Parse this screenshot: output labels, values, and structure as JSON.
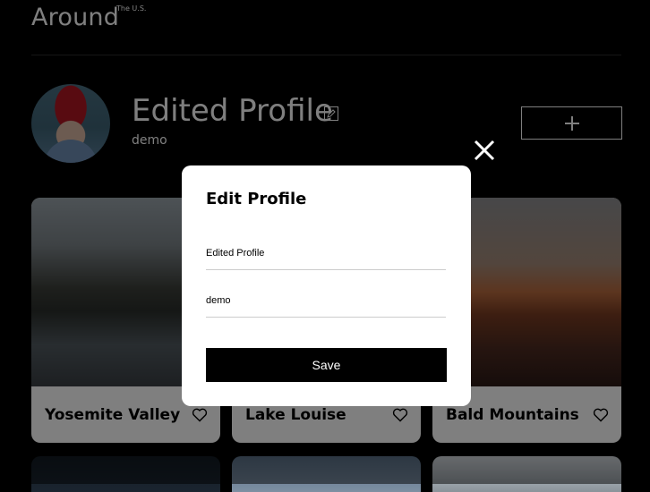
{
  "header": {
    "logo": "Around",
    "logo_sub": "The U.S."
  },
  "profile": {
    "name": "Edited Profile",
    "about": "demo"
  },
  "cards": [
    {
      "title": "Yosemite Valley"
    },
    {
      "title": "Lake Louise"
    },
    {
      "title": "Bald Mountains"
    }
  ],
  "modal": {
    "title": "Edit Profile",
    "name_value": "Edited Profile",
    "about_value": "demo",
    "save_label": "Save"
  },
  "icons": {
    "add": "plus-icon",
    "edit": "pencil-icon",
    "like": "heart-icon",
    "close": "close-icon"
  }
}
